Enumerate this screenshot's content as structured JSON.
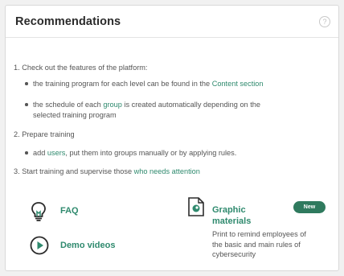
{
  "header": {
    "title": "Recommendations",
    "help_glyph": "?"
  },
  "steps": {
    "step1": {
      "text": "1. Check out the features of the platform:",
      "bullet1_text": "the training program for each level can be found in the ",
      "bullet1_link": "Content section",
      "bullet2_text_a": "the schedule of each ",
      "bullet2_link": "group",
      "bullet2_text_b": " is created automatically depending on the",
      "bullet2_text_c": "selected training program"
    },
    "step2": {
      "text": "2. Prepare training",
      "bullet1_text_a": "add ",
      "bullet1_link": "users",
      "bullet1_text_b": ", put them into groups manually or by applying rules."
    },
    "step3": {
      "text": "3. Start training and supervise those ",
      "link": "who needs attention"
    }
  },
  "resources": {
    "faq": {
      "label": "FAQ",
      "icon": "lightbulb-icon"
    },
    "demo": {
      "label": "Demo videos",
      "icon": "play-circle-icon"
    },
    "graphic": {
      "label_line1": "Graphic",
      "label_line2": "materials",
      "icon": "document-image-icon",
      "badge": "New",
      "desc_line1": "Print to remind employees of",
      "desc_line2": "the basic and main rules of",
      "desc_line3": "cybersecurity"
    }
  },
  "colors": {
    "accent": "#2f8a6e",
    "badge_bg": "#2f7a5e",
    "text": "#555555",
    "title": "#2b2b2b"
  }
}
